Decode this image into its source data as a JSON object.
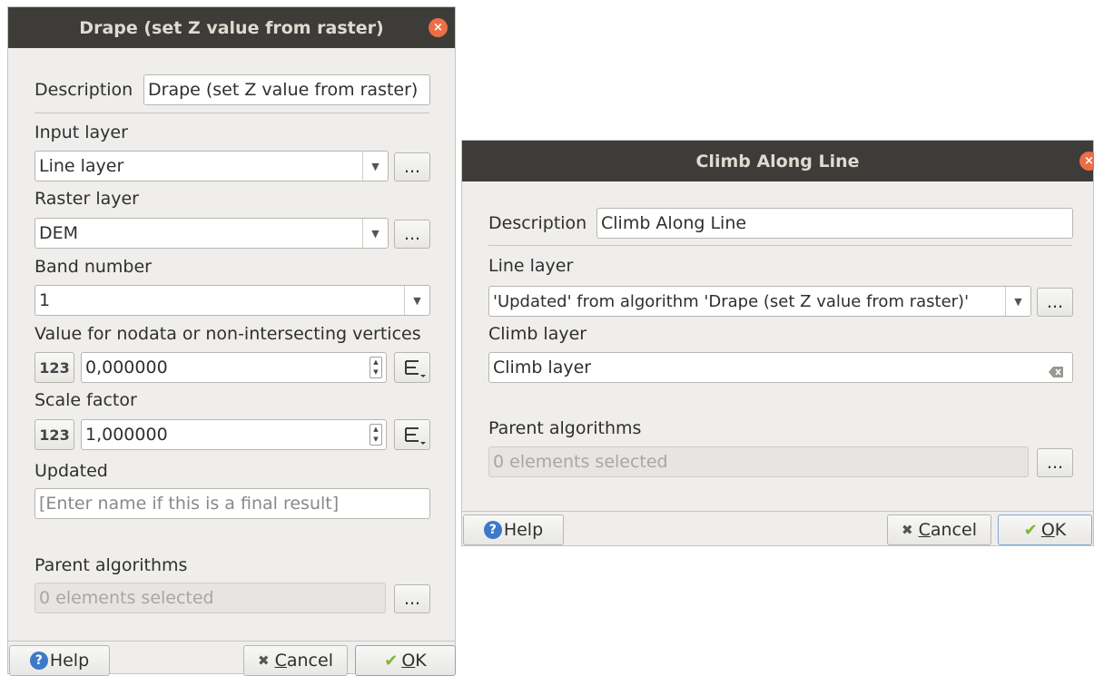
{
  "drape": {
    "title": "Drape (set Z value from raster)",
    "description_label": "Description",
    "description_value": "Drape (set Z value from raster)",
    "input_layer_label": "Input layer",
    "input_layer_value": "Line layer",
    "raster_layer_label": "Raster layer",
    "raster_layer_value": "DEM",
    "band_label": "Band number",
    "band_value": "1",
    "nodata_label": "Value for nodata or non-intersecting vertices",
    "nodata_value": "0,000000",
    "scale_label": "Scale factor",
    "scale_value": "1,000000",
    "numicon_text": "123",
    "updated_label": "Updated",
    "updated_placeholder": "[Enter name if this is a final result]",
    "parent_label": "Parent algorithms",
    "parent_value": "0 elements selected",
    "browse": "...",
    "help": "Help",
    "cancel_first": "C",
    "cancel_rest": "ancel",
    "ok_first": "O",
    "ok_rest": "K"
  },
  "climb": {
    "title": "Climb Along Line",
    "description_label": "Description",
    "description_value": "Climb Along Line",
    "line_layer_label": "Line layer",
    "line_layer_value": "'Updated' from algorithm 'Drape (set Z value from raster)'",
    "climb_layer_label": "Climb layer",
    "climb_layer_value": "Climb layer",
    "parent_label": "Parent algorithms",
    "parent_value": "0 elements selected",
    "browse": "...",
    "help": "Help",
    "cancel_first": "C",
    "cancel_rest": "ancel",
    "ok_first": "O",
    "ok_rest": "K"
  },
  "icons": {
    "close": "×",
    "dropdown": "▼",
    "spin_up": "▲",
    "spin_down": "▼",
    "help": "?",
    "cancel": "✖",
    "ok": "✔"
  },
  "colors": {
    "titlebar": "#3d3c38",
    "close_button": "#ec6e46",
    "help_icon": "#3d79c7",
    "ok_check": "#7fb530"
  }
}
